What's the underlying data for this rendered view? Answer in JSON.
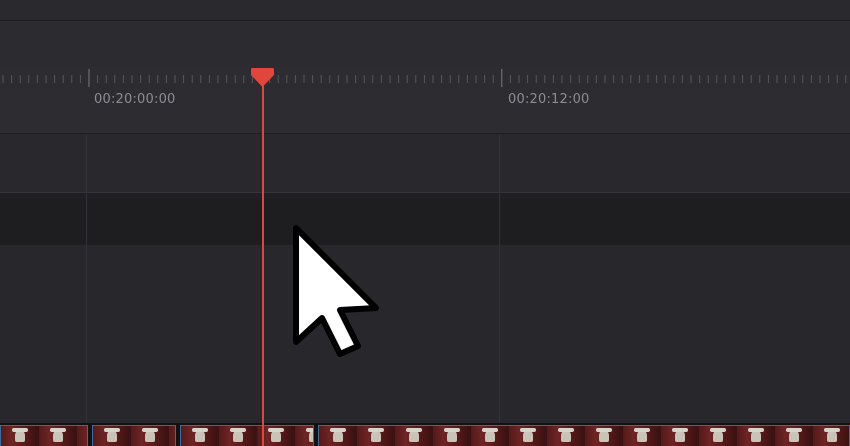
{
  "timeline": {
    "ruler": {
      "timecodes": [
        "00:20:00:00",
        "00:20:12:00"
      ]
    },
    "playhead": {
      "color": "#e0463c",
      "icon": "playhead-marker-icon"
    },
    "cursor": {
      "icon": "mouse-pointer-icon"
    },
    "clips": {
      "border_color": "#3f6b9c"
    }
  }
}
